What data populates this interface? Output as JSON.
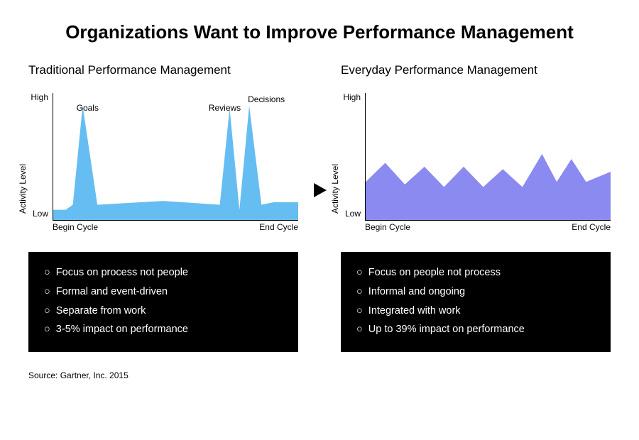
{
  "title": "Organizations Want to Improve Performance Management",
  "left": {
    "title": "Traditional Performance Management",
    "ylabel": "Activity Level",
    "yticks": {
      "high": "High",
      "low": "Low"
    },
    "xticks": {
      "begin": "Begin Cycle",
      "end": "End Cycle"
    },
    "peaks": {
      "goals": "Goals",
      "reviews": "Reviews",
      "decisions": "Decisions"
    },
    "bullets": [
      "Focus on process not people",
      "Formal and event-driven",
      "Separate from work",
      "3-5% impact on performance"
    ]
  },
  "right": {
    "title": "Everyday Performance Management",
    "ylabel": "Activity Level",
    "yticks": {
      "high": "High",
      "low": "Low"
    },
    "xticks": {
      "begin": "Begin Cycle",
      "end": "End Cycle"
    },
    "bullets": [
      "Focus on people not process",
      "Informal and ongoing",
      "Integrated with work",
      "Up to 39% impact on performance"
    ]
  },
  "source": "Source: Gartner, Inc. 2015",
  "colors": {
    "left_fill": "#66bdf1",
    "right_fill": "#8a8af0"
  },
  "chart_data": [
    {
      "type": "area",
      "title": "Traditional Performance Management",
      "xlabel": "",
      "ylabel": "Activity Level",
      "x_range": [
        "Begin Cycle",
        "End Cycle"
      ],
      "y_range": [
        "Low",
        "High"
      ],
      "x": [
        0,
        5,
        8,
        12,
        18,
        45,
        68,
        72,
        76,
        80,
        85,
        90,
        100
      ],
      "values": [
        8,
        8,
        12,
        90,
        12,
        15,
        12,
        88,
        8,
        90,
        12,
        14,
        14
      ],
      "annotations": [
        {
          "x": 12,
          "label": "Goals"
        },
        {
          "x": 72,
          "label": "Reviews"
        },
        {
          "x": 85,
          "label": "Decisions"
        }
      ]
    },
    {
      "type": "area",
      "title": "Everyday Performance Management",
      "xlabel": "",
      "ylabel": "Activity Level",
      "x_range": [
        "Begin Cycle",
        "End Cycle"
      ],
      "y_range": [
        "Low",
        "High"
      ],
      "x": [
        0,
        8,
        16,
        24,
        32,
        40,
        48,
        56,
        64,
        72,
        78,
        84,
        90,
        100
      ],
      "values": [
        30,
        45,
        28,
        42,
        26,
        42,
        26,
        40,
        26,
        52,
        30,
        48,
        30,
        38
      ]
    }
  ]
}
